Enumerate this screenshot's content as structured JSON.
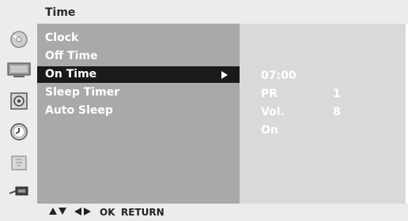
{
  "header": {
    "title": "Time"
  },
  "sidebar": {
    "icons": [
      "disc-icon",
      "tv-screen-icon",
      "speaker-icon",
      "clock-icon",
      "lock-icon",
      "input-plug-icon"
    ],
    "active_icon": "clock-icon"
  },
  "menu": {
    "items": [
      {
        "label": "Clock",
        "selected": false
      },
      {
        "label": "Off Time",
        "selected": false
      },
      {
        "label": "On Time",
        "selected": true
      },
      {
        "label": "Sleep Timer",
        "selected": false
      },
      {
        "label": "Auto Sleep",
        "selected": false
      }
    ]
  },
  "submenu": {
    "time": "07:00",
    "pr_label": "PR",
    "pr_value": "1",
    "vol_label": "Vol.",
    "vol_value": "8",
    "state": "On"
  },
  "footer": {
    "ok_label": "OK",
    "return_label": "RETURN"
  },
  "colors": {
    "menu_bg": "#a9a9a9",
    "selected_bg": "#1a1a1a",
    "submenu_bg": "#d9d9d9",
    "chrome_bg": "#ececec"
  }
}
